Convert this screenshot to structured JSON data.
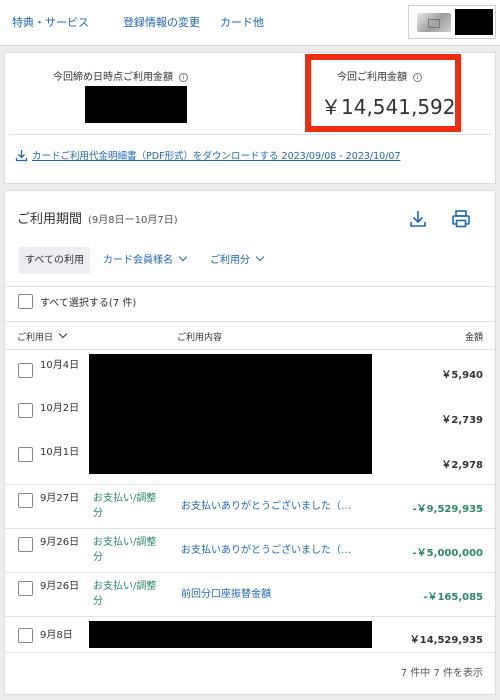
{
  "nav": {
    "items": [
      {
        "label": "特典・サービス"
      },
      {
        "label": "登録情報の変更"
      },
      {
        "label": "カード他"
      }
    ]
  },
  "summary": {
    "current_label": "今回締め日時点ご利用金額",
    "statement_label": "今回ご利用金額",
    "statement_amount": "￥14,541,592",
    "download_link": "カードご利用代金明細書（PDF形式）をダウンロードする 2023/09/08 - 2023/10/07"
  },
  "activity": {
    "title": "ご利用期間",
    "range": "(9月8日ー10月7日)",
    "filters": {
      "all": "すべての利用",
      "member": "カード会員様名",
      "usage": "ご利用分"
    },
    "select_all": "すべて選択する(7 件)",
    "columns": {
      "date": "ご利用日",
      "description": "ご利用内容",
      "amount": "金額"
    },
    "rows": [
      {
        "date": "10月4日",
        "category": "",
        "description": "",
        "amount": "￥5,940"
      },
      {
        "date": "10月2日",
        "category": "",
        "description": "",
        "amount": "￥2,739"
      },
      {
        "date": "10月1日",
        "category": "",
        "description": "",
        "amount": "￥2,978"
      },
      {
        "date": "9月27日",
        "category": "お支払い/調整分",
        "description": "お支払いありがとうございました（…",
        "amount": "-￥9,529,935"
      },
      {
        "date": "9月26日",
        "category": "お支払い/調整分",
        "description": "お支払いありがとうございました（…",
        "amount": "-￥5,000,000"
      },
      {
        "date": "9月26日",
        "category": "お支払い/調整分",
        "description": "前回分口座振替金額",
        "amount": "-￥165,085"
      },
      {
        "date": "9月8日",
        "category": "",
        "description": "",
        "amount": "￥14,529,935"
      }
    ],
    "pager": "7 件中 7 件を表示"
  },
  "colors": {
    "link": "#1e67b7",
    "highlight": "#ef2c10",
    "credit": "#2a8a64"
  },
  "icons": [
    "card-thumbnail",
    "info-icon",
    "download-icon",
    "print-icon",
    "chevron-down-icon",
    "checkbox"
  ]
}
